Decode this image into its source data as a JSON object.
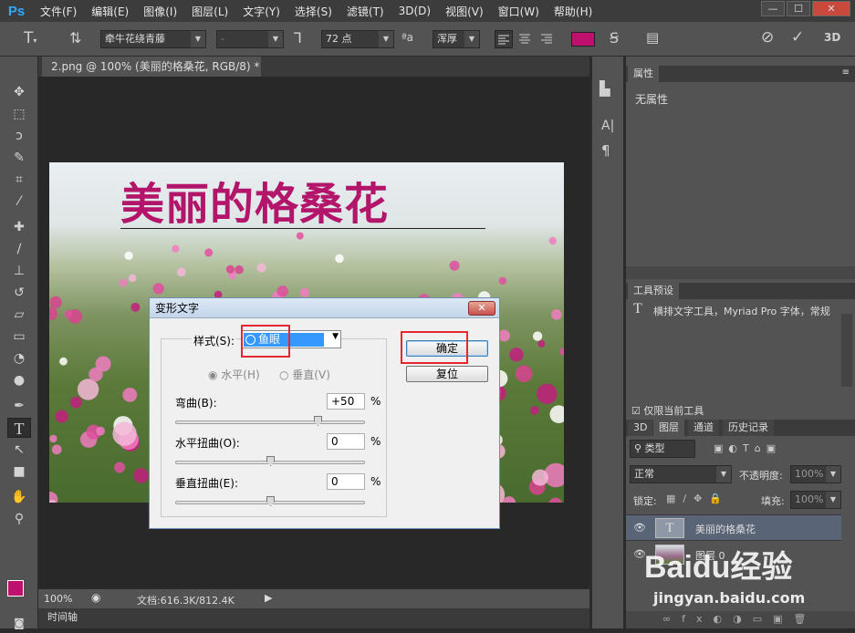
{
  "app": {
    "logo": "Ps",
    "accent": "#31a8ff"
  },
  "menu": [
    "文件(F)",
    "编辑(E)",
    "图像(I)",
    "图层(L)",
    "文字(Y)",
    "选择(S)",
    "滤镜(T)",
    "3D(D)",
    "视图(V)",
    "窗口(W)",
    "帮助(H)"
  ],
  "window_controls": {
    "min": "—",
    "max": "☐",
    "close": "✕"
  },
  "options": {
    "font_family": "牵牛花绕青藤",
    "font_style": "-",
    "font_size": "72 点",
    "aa_label": "ªa",
    "antialias": "浑厚",
    "text_color": "#c0106f",
    "three_d": "3D"
  },
  "document": {
    "tab": "2.png @ 100% (美丽的格桑花, RGB/8) *",
    "close": "×",
    "title_text": "美丽的格桑花",
    "title_color": "#b2156a"
  },
  "status": {
    "zoom": "100%",
    "doc": "文档:616.3K/812.4K"
  },
  "timeline": "时间轴",
  "panels": {
    "properties": {
      "tab": "属性",
      "content": "无属性"
    },
    "tool_presets": {
      "tab": "工具预设",
      "item": "横排文字工具，Myriad Pro 字体，常规",
      "only_current": "仅限当前工具"
    },
    "layers": {
      "tabs": [
        "3D",
        "图层",
        "通道",
        "历史记录"
      ],
      "filter": "类型",
      "blend": "正常",
      "opacity_label": "不透明度:",
      "opacity": "100%",
      "lock_label": "锁定:",
      "fill_label": "填充:",
      "fill": "100%",
      "rows": [
        {
          "name": "美丽的格桑花",
          "thumb": "T",
          "selected": true
        },
        {
          "name": "图层 0",
          "thumb": "",
          "selected": false
        }
      ]
    }
  },
  "dialog": {
    "title": "变形文字",
    "style_label": "样式(S):",
    "style_value": "鱼眼",
    "horizontal": "水平(H)",
    "vertical": "垂直(V)",
    "bend_label": "弯曲(B):",
    "bend": "+50",
    "hdist_label": "水平扭曲(O):",
    "hdist": "0",
    "vdist_label": "垂直扭曲(E):",
    "vdist": "0",
    "pct": "%",
    "ok": "确定",
    "reset": "复位",
    "bend_level": 0.75,
    "hdist_level": 0.5,
    "vdist_level": 0.5
  },
  "watermark": {
    "brand": "Baidu经验",
    "url": "jingyan.baidu.com"
  }
}
